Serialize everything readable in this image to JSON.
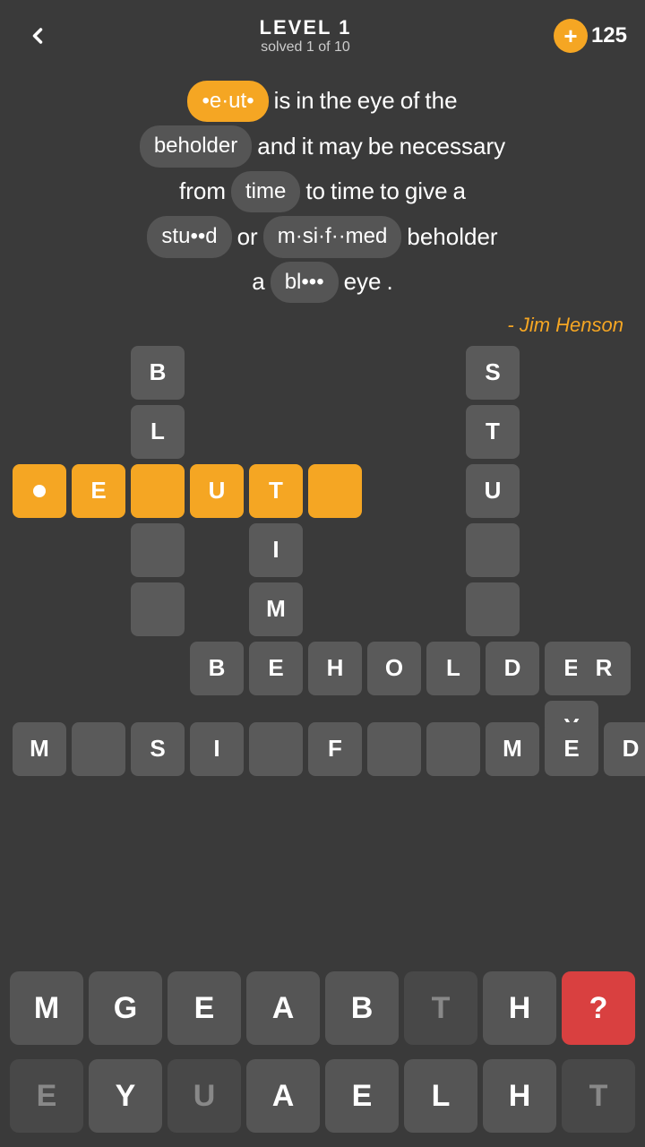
{
  "header": {
    "back_label": "←",
    "level_title": "LEVEL 1",
    "solved_text": "solved 1 of 10",
    "plus_label": "+",
    "coins": "125"
  },
  "quote": {
    "line1": [
      "•e·ut•",
      "is",
      "in",
      "the",
      "eye",
      "of",
      "the"
    ],
    "line2": [
      "beholder",
      "and",
      "it",
      "may",
      "be",
      "necessary"
    ],
    "line3": [
      "from",
      "time",
      "to",
      "time",
      "to",
      "give",
      "a"
    ],
    "line4": [
      "stu••d",
      "or",
      "m·si·f··med",
      "beholder"
    ],
    "line5": [
      "a",
      "bl•••",
      "eye",
      "."
    ],
    "attribution": "- Jim Henson"
  },
  "grid": {
    "tiles": [
      {
        "letter": "B",
        "col": 2,
        "row": 0,
        "type": "gray"
      },
      {
        "letter": "S",
        "col": 8,
        "row": 0,
        "type": "gray"
      },
      {
        "letter": "L",
        "col": 2,
        "row": 1,
        "type": "gray"
      },
      {
        "letter": "T",
        "col": 8,
        "row": 1,
        "type": "gray"
      },
      {
        "letter": "•",
        "col": 0,
        "row": 2,
        "type": "dot"
      },
      {
        "letter": "E",
        "col": 1,
        "row": 2,
        "type": "yellow"
      },
      {
        "letter": "",
        "col": 2,
        "row": 2,
        "type": "yellow"
      },
      {
        "letter": "U",
        "col": 3,
        "row": 2,
        "type": "yellow"
      },
      {
        "letter": "T",
        "col": 4,
        "row": 2,
        "type": "yellow"
      },
      {
        "letter": "",
        "col": 5,
        "row": 2,
        "type": "yellow"
      },
      {
        "letter": "U",
        "col": 8,
        "row": 2,
        "type": "gray"
      },
      {
        "letter": "",
        "col": 2,
        "row": 3,
        "type": "gray"
      },
      {
        "letter": "I",
        "col": 4,
        "row": 3,
        "type": "gray"
      },
      {
        "letter": "",
        "col": 8,
        "row": 3,
        "type": "gray"
      },
      {
        "letter": "",
        "col": 2,
        "row": 4,
        "type": "gray"
      },
      {
        "letter": "M",
        "col": 4,
        "row": 4,
        "type": "gray"
      },
      {
        "letter": "",
        "col": 8,
        "row": 4,
        "type": "gray"
      },
      {
        "letter": "B",
        "col": 3,
        "row": 5,
        "type": "gray"
      },
      {
        "letter": "E",
        "col": 4,
        "row": 5,
        "type": "gray"
      },
      {
        "letter": "H",
        "col": 5,
        "row": 5,
        "type": "gray"
      },
      {
        "letter": "O",
        "col": 6,
        "row": 5,
        "type": "gray"
      },
      {
        "letter": "L",
        "col": 7,
        "row": 5,
        "type": "gray"
      },
      {
        "letter": "D",
        "col": 8,
        "row": 5,
        "type": "gray"
      },
      {
        "letter": "E",
        "col": 9,
        "row": 5,
        "type": "gray"
      },
      {
        "letter": "R",
        "col": 10,
        "row": 5,
        "type": "gray"
      },
      {
        "letter": "Y",
        "col": 9,
        "row": 6,
        "type": "gray"
      },
      {
        "letter": "M",
        "col": 0,
        "row": 7,
        "type": "gray"
      },
      {
        "letter": "",
        "col": 1,
        "row": 7,
        "type": "gray"
      },
      {
        "letter": "S",
        "col": 2,
        "row": 7,
        "type": "gray"
      },
      {
        "letter": "I",
        "col": 3,
        "row": 7,
        "type": "gray"
      },
      {
        "letter": "",
        "col": 4,
        "row": 7,
        "type": "gray"
      },
      {
        "letter": "F",
        "col": 5,
        "row": 7,
        "type": "gray"
      },
      {
        "letter": "",
        "col": 6,
        "row": 7,
        "type": "gray"
      },
      {
        "letter": "",
        "col": 7,
        "row": 7,
        "type": "gray"
      },
      {
        "letter": "M",
        "col": 8,
        "row": 7,
        "type": "gray"
      },
      {
        "letter": "E",
        "col": 9,
        "row": 7,
        "type": "gray"
      },
      {
        "letter": "D",
        "col": 10,
        "row": 7,
        "type": "gray"
      }
    ]
  },
  "keyboard_row1": [
    "M",
    "G",
    "E",
    "A",
    "B",
    "T",
    "H",
    "?"
  ],
  "keyboard_row2": [
    "E",
    "Y",
    "U",
    "A",
    "E",
    "L",
    "H",
    "T"
  ]
}
